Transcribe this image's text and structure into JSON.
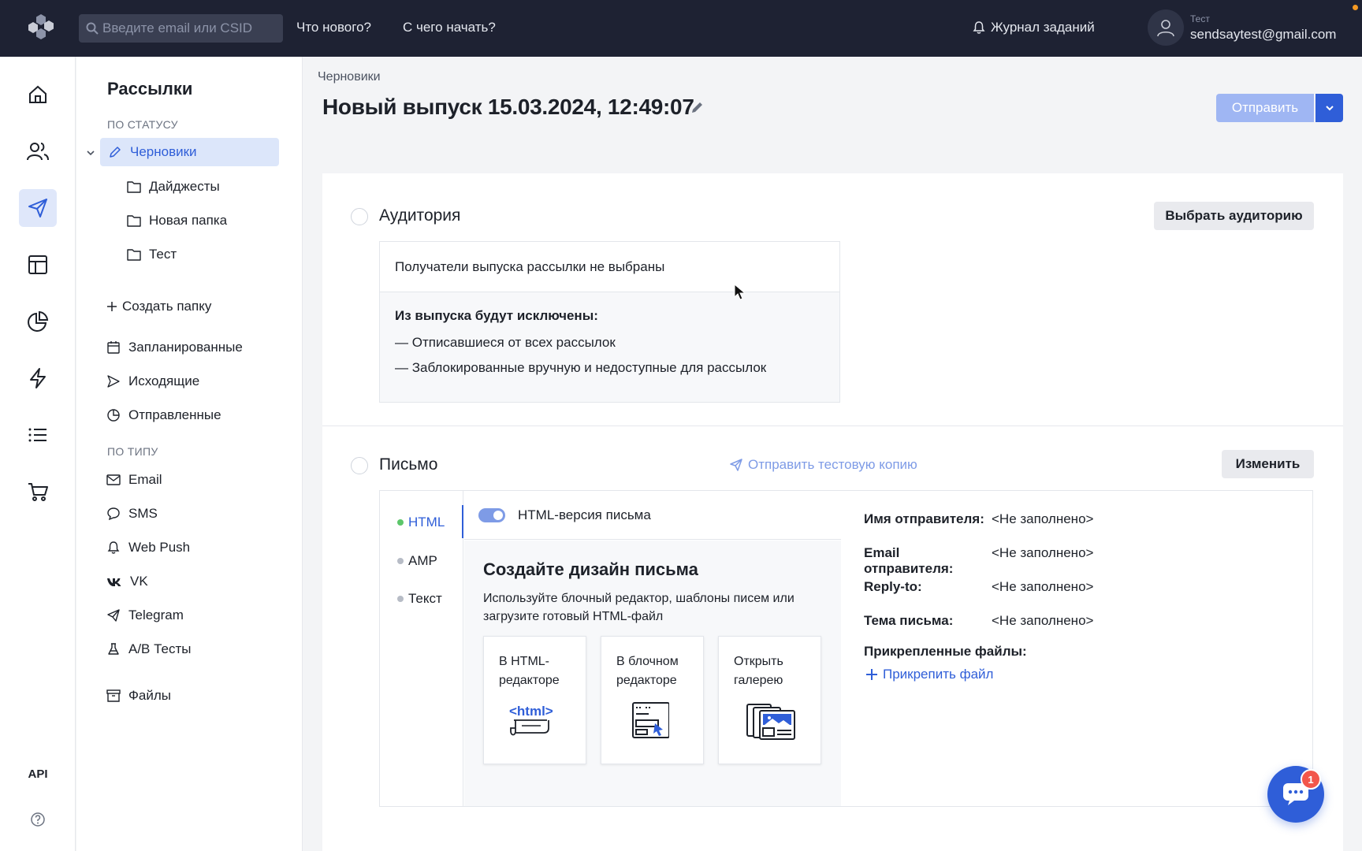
{
  "topbar": {
    "search_placeholder": "Введите email или CSID",
    "whats_new": "Что нового?",
    "getting_started": "С чего начать?",
    "jobs_log": "Журнал заданий",
    "user_label": "Тест",
    "user_email": "sendsaytest@gmail.com"
  },
  "rail": {
    "api": "API"
  },
  "sidebar": {
    "title": "Рассылки",
    "by_status": "ПО СТАТУСУ",
    "drafts": "Черновики",
    "folders": [
      "Дайджесты",
      "Новая папка",
      "Тест"
    ],
    "create_folder": "Создать папку",
    "scheduled": "Запланированные",
    "outgoing": "Исходящие",
    "sent": "Отправленные",
    "by_type": "ПО ТИПУ",
    "types": [
      "Email",
      "SMS",
      "Web Push",
      "VK",
      "Telegram",
      "A/B Тесты"
    ],
    "files": "Файлы"
  },
  "main": {
    "breadcrumb": "Черновики",
    "title": "Новый выпуск 15.03.2024, 12:49:07",
    "send_label": "Отправить"
  },
  "audience": {
    "title": "Аудитория",
    "select_btn": "Выбрать аудиторию",
    "none_selected": "Получатели выпуска рассылки не выбраны",
    "excluded_heading": "Из выпуска будут исключены:",
    "excluded": [
      "— Отписавшиеся от всех рассылок",
      "— Заблокированные вручную и недоступные для рассылок"
    ]
  },
  "letter": {
    "title": "Письмо",
    "test_copy": "Отправить тестовую копию",
    "change_btn": "Изменить",
    "tabs": [
      "HTML",
      "AMP",
      "Текст"
    ],
    "html_version": "HTML-версия письма",
    "design_title": "Создайте дизайн письма",
    "design_desc": "Используйте блочный редактор, шаблоны писем или загрузите готовый HTML-файл",
    "options": [
      "В HTML-редакторе",
      "В блочном редакторе",
      "Открыть галерею"
    ],
    "html_icon_text": "<html>",
    "meta": [
      {
        "k": "Имя отправителя:",
        "v": "<Не заполнено>"
      },
      {
        "k": "Email отправителя:",
        "v": "<Не заполнено>"
      },
      {
        "k": "Reply-to:",
        "v": "<Не заполнено>"
      },
      {
        "k": "Тема письма:",
        "v": "<Не заполнено>"
      }
    ],
    "attachments_label": "Прикрепленные файлы:",
    "attach_file": "Прикрепить файл"
  },
  "chat": {
    "badge": "1"
  },
  "colors": {
    "accent": "#2f5ed8",
    "topbar": "#1e2233",
    "active_bg": "#dce6fa"
  }
}
